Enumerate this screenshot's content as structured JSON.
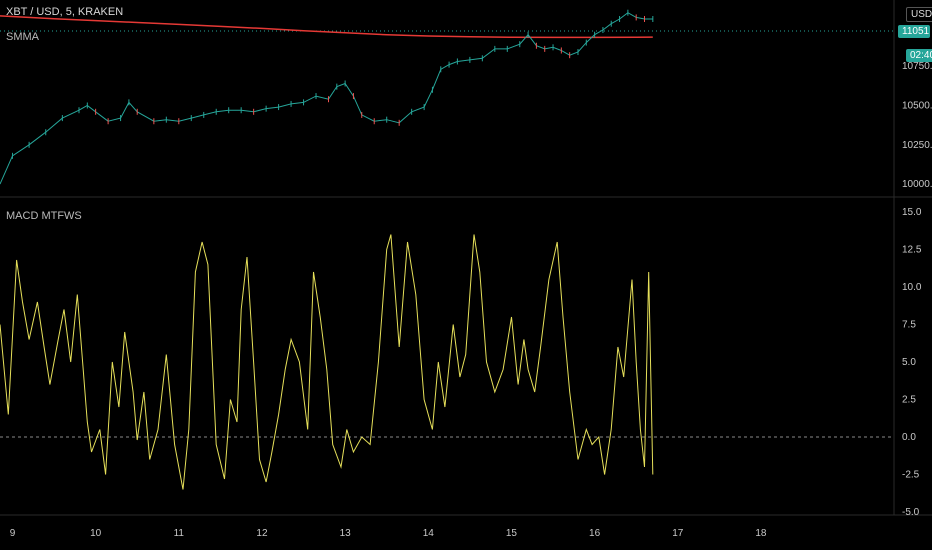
{
  "symbol_label": "XBT / USD, 5, KRAKEN",
  "currency_button": "USD",
  "price_badge": "11051.7",
  "countdown_badge": "02:40",
  "colors": {
    "background": "#000000",
    "candle_up": "#26a69a",
    "candle_down": "#ef5350",
    "smma": "#e53935",
    "macd": "#e6e05a",
    "price_badge_bg": "#26a69a",
    "grid_sep": "#2a2a2a"
  },
  "chart_data": [
    {
      "type": "line",
      "title": "SMMA",
      "x_ticks": [
        "9",
        "10",
        "11",
        "12",
        "13",
        "14",
        "15",
        "16",
        "17",
        "18"
      ],
      "y_ticks": [
        "10750.0",
        "10500.0",
        "10250.0",
        "10000.0"
      ],
      "ylim": [
        9950,
        11120
      ],
      "xlim": [
        8.85,
        19.6
      ],
      "series": [
        {
          "name": "SMMA",
          "x": [
            8.85,
            9.5,
            10.0,
            10.5,
            11.0,
            11.5,
            12.0,
            12.5,
            13.0,
            13.5,
            14.0,
            14.5,
            15.0,
            15.5,
            16.0,
            16.5,
            16.7
          ],
          "values": [
            11070,
            11052,
            11040,
            11028,
            11016,
            11003,
            10990,
            10975,
            10962,
            10950,
            10942,
            10937,
            10934,
            10933,
            10933,
            10934,
            10935
          ]
        },
        {
          "name": "XBT / USD",
          "x": [
            8.85,
            9.0,
            9.2,
            9.4,
            9.6,
            9.8,
            9.9,
            10.0,
            10.15,
            10.3,
            10.4,
            10.5,
            10.7,
            10.85,
            11.0,
            11.15,
            11.3,
            11.45,
            11.6,
            11.75,
            11.9,
            12.05,
            12.2,
            12.35,
            12.5,
            12.65,
            12.8,
            12.9,
            13.0,
            13.1,
            13.2,
            13.35,
            13.5,
            13.65,
            13.8,
            13.95,
            14.05,
            14.15,
            14.25,
            14.35,
            14.5,
            14.65,
            14.8,
            14.95,
            15.1,
            15.2,
            15.3,
            15.4,
            15.5,
            15.6,
            15.7,
            15.8,
            15.9,
            16.0,
            16.1,
            16.2,
            16.3,
            16.4,
            16.5,
            16.6,
            16.7
          ],
          "values": [
            10000,
            10180,
            10250,
            10330,
            10420,
            10470,
            10500,
            10460,
            10400,
            10420,
            10520,
            10460,
            10400,
            10410,
            10400,
            10420,
            10440,
            10460,
            10470,
            10470,
            10460,
            10480,
            10490,
            10510,
            10520,
            10560,
            10540,
            10620,
            10640,
            10560,
            10440,
            10400,
            10410,
            10390,
            10460,
            10490,
            10600,
            10730,
            10760,
            10780,
            10790,
            10800,
            10860,
            10860,
            10890,
            10950,
            10880,
            10860,
            10870,
            10850,
            10820,
            10840,
            10900,
            10950,
            10980,
            11020,
            11050,
            11090,
            11060,
            11050,
            11050
          ]
        }
      ]
    },
    {
      "type": "line",
      "title": "MACD MTFWS",
      "x_ticks": [
        "9",
        "10",
        "11",
        "12",
        "13",
        "14",
        "15",
        "16",
        "17",
        "18"
      ],
      "y_ticks": [
        "15.0",
        "12.5",
        "10.0",
        "7.5",
        "5.0",
        "2.5",
        "0.0",
        "-2.5",
        "-5.0"
      ],
      "ylim": [
        -5.0,
        15.0
      ],
      "xlim": [
        8.85,
        19.6
      ],
      "zero_line": 0.0,
      "series": [
        {
          "name": "MACD MTFWS",
          "x": [
            8.85,
            8.95,
            9.05,
            9.12,
            9.2,
            9.3,
            9.38,
            9.45,
            9.55,
            9.62,
            9.7,
            9.78,
            9.85,
            9.9,
            9.95,
            10.05,
            10.12,
            10.2,
            10.28,
            10.35,
            10.45,
            10.5,
            10.58,
            10.65,
            10.75,
            10.85,
            10.95,
            11.05,
            11.12,
            11.2,
            11.28,
            11.35,
            11.45,
            11.55,
            11.62,
            11.7,
            11.75,
            11.82,
            11.9,
            11.97,
            12.05,
            12.12,
            12.2,
            12.28,
            12.35,
            12.45,
            12.55,
            12.62,
            12.7,
            12.78,
            12.85,
            12.95,
            13.02,
            13.1,
            13.2,
            13.3,
            13.4,
            13.5,
            13.55,
            13.65,
            13.75,
            13.85,
            13.95,
            14.05,
            14.12,
            14.2,
            14.3,
            14.38,
            14.45,
            14.55,
            14.62,
            14.7,
            14.8,
            14.9,
            15.0,
            15.08,
            15.15,
            15.2,
            15.28,
            15.35,
            15.45,
            15.55,
            15.62,
            15.7,
            15.8,
            15.9,
            15.97,
            16.05,
            16.12,
            16.2,
            16.28,
            16.35,
            16.45,
            16.5,
            16.55,
            16.6,
            16.65,
            16.7
          ],
          "values": [
            7.5,
            1.5,
            11.8,
            9.0,
            6.5,
            9.0,
            6.0,
            3.5,
            6.5,
            8.5,
            5.0,
            9.5,
            4.5,
            1.0,
            -1.0,
            0.5,
            -2.5,
            5.0,
            2.0,
            7.0,
            3.0,
            -0.2,
            3.0,
            -1.5,
            0.5,
            5.5,
            -0.5,
            -3.5,
            0.5,
            11.0,
            13.0,
            11.5,
            -0.5,
            -2.8,
            2.5,
            1.0,
            8.5,
            12.0,
            5.0,
            -1.5,
            -3.0,
            -1.0,
            1.5,
            4.5,
            6.5,
            5.0,
            0.5,
            11.0,
            8.0,
            4.5,
            -0.5,
            -2.0,
            0.5,
            -1.0,
            0.0,
            -0.5,
            5.0,
            12.5,
            13.5,
            6.0,
            13.0,
            9.5,
            2.5,
            0.5,
            5.0,
            2.0,
            7.5,
            4.0,
            5.5,
            13.5,
            11.0,
            5.0,
            3.0,
            4.5,
            8.0,
            3.5,
            6.5,
            4.5,
            3.0,
            6.0,
            10.5,
            13.0,
            8.0,
            3.0,
            -1.5,
            0.5,
            -0.5,
            0.0,
            -2.5,
            0.5,
            6.0,
            4.0,
            10.5,
            5.0,
            0.5,
            -2.0,
            11.0,
            -2.5
          ]
        }
      ]
    }
  ]
}
